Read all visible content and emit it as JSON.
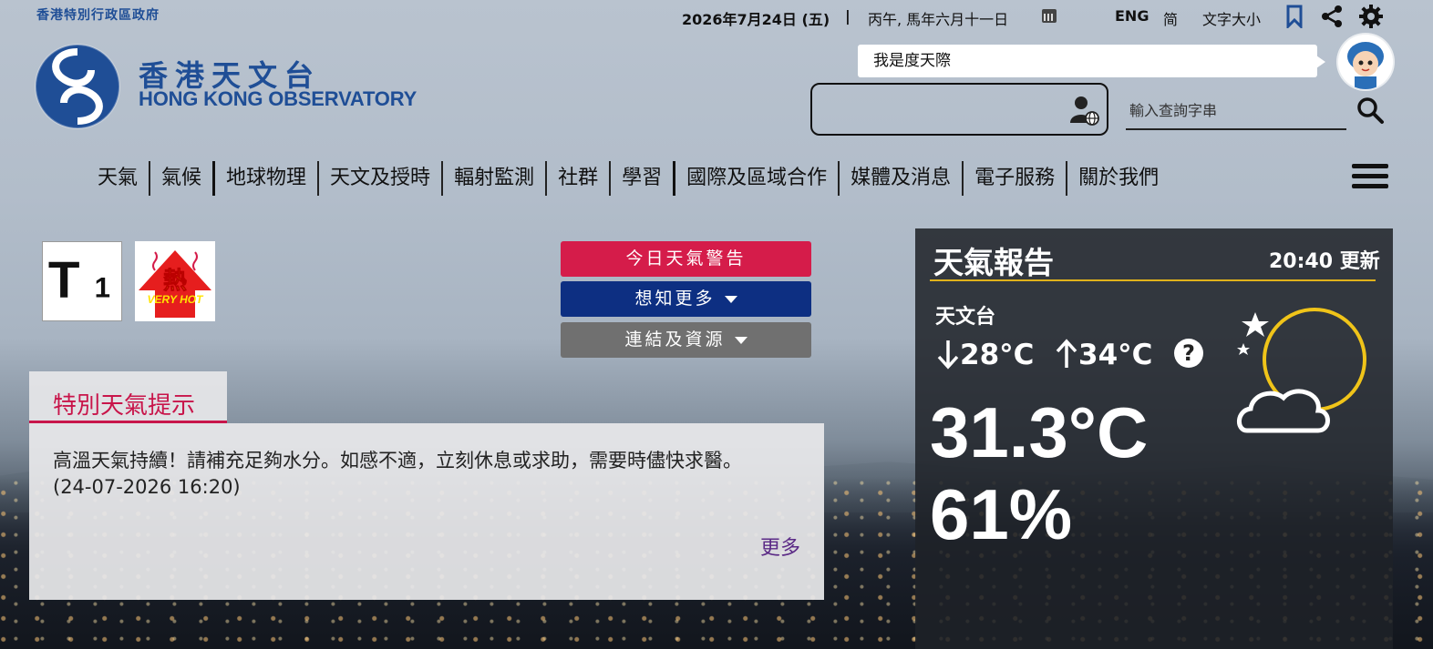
{
  "header": {
    "gov_label": "香港特別行政區政府",
    "date": "2026年7月24日 (五)",
    "separator": "|",
    "lunar_date": "丙午, 馬年六月十一日",
    "lang_eng": "ENG",
    "lang_sc": "简",
    "font_size": "文字大小"
  },
  "logo": {
    "name_zh": "香港天文台",
    "name_en": "HONG KONG OBSERVATORY"
  },
  "chatbot": {
    "bubble_text": "我是度天際"
  },
  "search": {
    "placeholder": "輸入查詢字串",
    "value": ""
  },
  "nav": {
    "items": [
      "天氣",
      "氣候",
      "地球物理",
      "天文及授時",
      "輻射監測",
      "社群",
      "學習",
      "國際及區域合作",
      "媒體及消息",
      "電子服務",
      "關於我們"
    ]
  },
  "signals": {
    "typhoon_code": "T",
    "typhoon_num": "1",
    "hot_zh": "熱",
    "hot_en": "VERY HOT"
  },
  "buttons": {
    "warnings": "今日天氣警告",
    "learn_more": "想知更多",
    "links": "連結及資源"
  },
  "special_tip": {
    "tab_label": "特別天氣提示",
    "text": "高溫天氣持續！請補充足夠水分。如感不適，立刻休息或求助，需要時儘快求醫。",
    "timestamp": "(24-07-2026 16:20)",
    "more_label": "更多"
  },
  "weather_report": {
    "title": "天氣報告",
    "update": "20:40 更新",
    "station": "天文台",
    "min_temp": "28°C",
    "max_temp": "34°C",
    "temperature": "31.3°C",
    "humidity": "61%",
    "accent_color": "#e0b21b",
    "icon": "night-partly-cloudy-icon"
  },
  "colors": {
    "brand_blue": "#1f4e96",
    "warning_red": "#d51c4a",
    "learn_more_blue": "#0d2f82",
    "links_gray": "#707070",
    "tip_pink": "#c8154a"
  }
}
